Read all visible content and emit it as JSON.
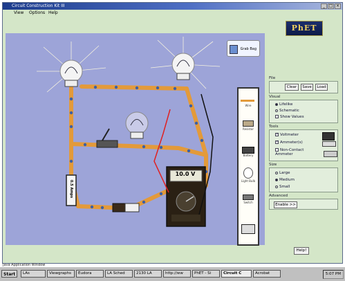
{
  "window": {
    "title": "Circuit Construction Kit III"
  },
  "menu": {
    "items": [
      "View",
      "Options",
      "Help"
    ]
  },
  "canvas": {
    "grab_bag_label": "Grab Bag",
    "ammeter_label": "0.5 Amps",
    "voltmeter_reading": "10.0 V",
    "palette": [
      "Wire",
      "Resistor",
      "Battery",
      "Light Bulb",
      "Switch"
    ]
  },
  "panel": {
    "logo": "PhET",
    "file": {
      "title": "File",
      "buttons": [
        "Clear",
        "Save",
        "Load"
      ]
    },
    "visual": {
      "title": "Visual",
      "options": [
        {
          "label": "Lifelike",
          "selected": true
        },
        {
          "label": "Schematic",
          "selected": false
        }
      ],
      "show_values": "Show Values"
    },
    "tools": {
      "title": "Tools",
      "items": [
        {
          "label": "Voltmeter",
          "checked": true
        },
        {
          "label": "Ammeter(s)",
          "checked": true
        },
        {
          "label": "Non-Contact Ammeter",
          "checked": false
        }
      ]
    },
    "size": {
      "title": "Size",
      "options": [
        {
          "label": "Large",
          "selected": false
        },
        {
          "label": "Medium",
          "selected": true
        },
        {
          "label": "Small",
          "selected": false
        }
      ]
    },
    "advanced": {
      "title": "Advanced",
      "button": "Enable >>"
    },
    "help_button": "Help!"
  },
  "status_hint": "Java Application Window",
  "taskbar": {
    "start": "Start",
    "items": [
      {
        "label": "LAs",
        "active": false
      },
      {
        "label": "Viewgraphs",
        "active": false
      },
      {
        "label": "Eudora",
        "active": false
      },
      {
        "label": "LA Sched",
        "active": false
      },
      {
        "label": "2130 LA",
        "active": false
      },
      {
        "label": "http://ww",
        "active": false
      },
      {
        "label": "PhET - Si",
        "active": false
      },
      {
        "label": "Circuit C",
        "active": true
      },
      {
        "label": "Acrobat",
        "active": false
      }
    ],
    "clock": "5:07 PM"
  }
}
